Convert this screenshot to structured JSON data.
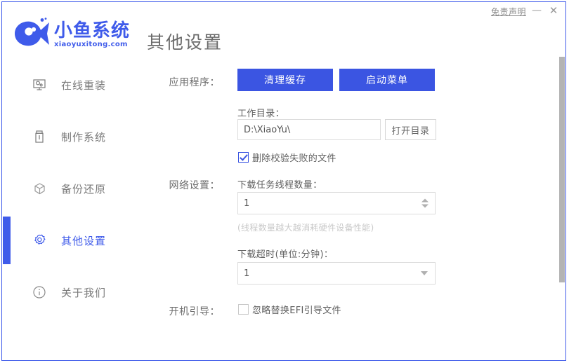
{
  "window": {
    "border_color": "#3f5bea",
    "disclaimer_label": "免责声明",
    "minimize_label": "—",
    "close_label": "✕"
  },
  "brand": {
    "name_cn": "小鱼系统",
    "name_en": "xiaoyuxitong.com",
    "logo_color": "#3f5bea",
    "logo_icon": "fish-logo-icon"
  },
  "header": {
    "page_title": "其他设置"
  },
  "sidebar": {
    "items": [
      {
        "label": "在线重装",
        "icon": "monitor-icon",
        "active": false
      },
      {
        "label": "制作系统",
        "icon": "usb-drive-icon",
        "active": false
      },
      {
        "label": "备份还原",
        "icon": "shield-box-icon",
        "active": false
      },
      {
        "label": "其他设置",
        "icon": "gear-icon",
        "active": true
      },
      {
        "label": "关于我们",
        "icon": "info-circle-icon",
        "active": false
      }
    ],
    "active_color": "#3f5bea",
    "inactive_color": "#7a7a7a"
  },
  "main": {
    "sections": [
      {
        "row_label": "应用程序：",
        "buttons": [
          {
            "label": "清理缓存",
            "style": "primary"
          },
          {
            "label": "启动菜单",
            "style": "primary"
          }
        ],
        "work_dir_label": "工作目录：",
        "work_dir_value": "D:\\XiaoYu\\",
        "open_dir_button": "打开目录",
        "delete_failed_checkbox": {
          "label": "删除校验失败的文件",
          "checked": true
        }
      },
      {
        "row_label": "网络设置：",
        "thread_count_label": "下载任务线程数量：",
        "thread_count_value": "1",
        "thread_hint": "(线程数量越大越消耗硬件设备性能)",
        "timeout_label": "下载超时(单位:分钟)：",
        "timeout_value": "1",
        "timeout_options": [
          "1"
        ]
      },
      {
        "row_label": "开机引导：",
        "efi_checkbox": {
          "label": "忽略替换EFI引导文件",
          "checked": false
        }
      }
    ]
  },
  "scrollbar": {
    "thumb_color": "#b4b4b4",
    "position_pct": 5
  },
  "colors": {
    "primary": "#3b55e2",
    "text": "#6e6e6e",
    "hint": "#c9c9c9"
  }
}
